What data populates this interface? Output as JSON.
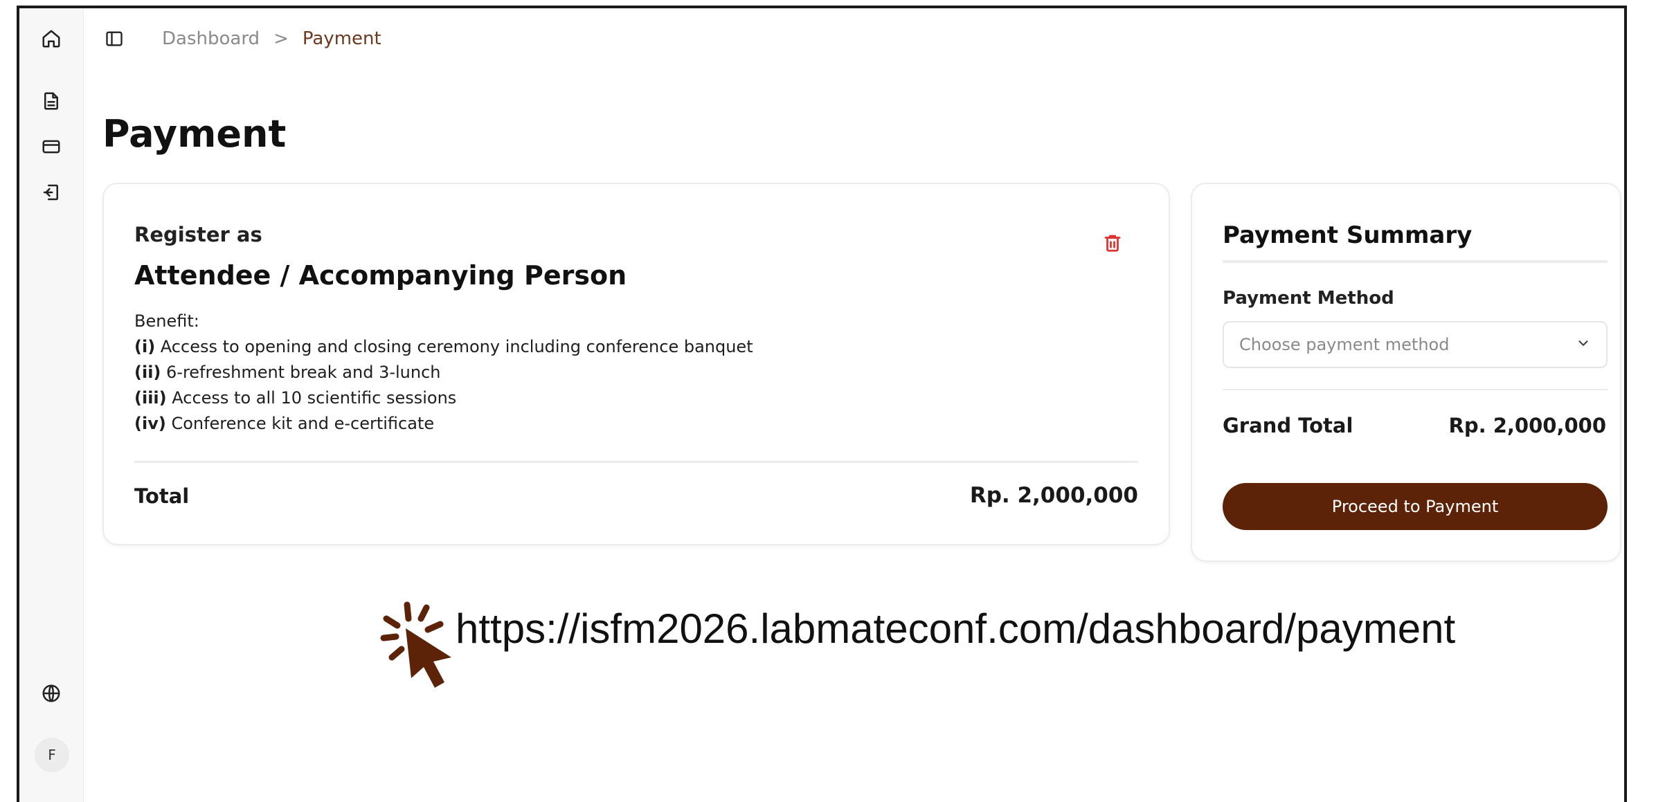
{
  "breadcrumb": {
    "parent": "Dashboard",
    "separator": ">",
    "current": "Payment"
  },
  "page": {
    "title": "Payment"
  },
  "sidebar": {
    "items": [
      {
        "name": "home",
        "icon": "home-icon"
      },
      {
        "name": "documents",
        "icon": "document-icon"
      },
      {
        "name": "payment",
        "icon": "card-icon"
      },
      {
        "name": "logout",
        "icon": "logout-icon"
      }
    ],
    "language_icon": "globe-icon",
    "avatar_initial": "F"
  },
  "registration": {
    "label": "Register as",
    "type": "Attendee / Accompanying Person",
    "benefit_title": "Benefit:",
    "benefits": [
      {
        "num": "(i)",
        "text": " Access to opening and closing ceremony including conference banquet"
      },
      {
        "num": "(ii)",
        "text": " 6-refreshment break and 3-lunch"
      },
      {
        "num": "(iii)",
        "text": " Access to all 10 scientific sessions"
      },
      {
        "num": "(iv)",
        "text": " Conference kit and e-certificate"
      }
    ],
    "total_label": "Total",
    "total_value": "Rp. 2,000,000"
  },
  "summary": {
    "title": "Payment Summary",
    "method_label": "Payment Method",
    "method_placeholder": "Choose payment method",
    "grand_total_label": "Grand Total",
    "grand_total_value": "Rp. 2,000,000",
    "proceed_label": "Proceed to Payment"
  },
  "overlay": {
    "url": "https://isfm2026.labmateconf.com/dashboard/payment"
  },
  "colors": {
    "brand": "#5c2308",
    "breadcrumb_active": "#6b3a1f",
    "delete": "#e0322f",
    "pointer": "#5c2308"
  }
}
